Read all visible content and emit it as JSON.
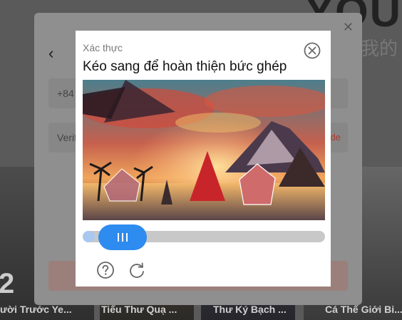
{
  "background": {
    "logo_text": "YOU",
    "side_text": "我的",
    "number_text": "2",
    "posters": [
      {
        "title": "ười Trước Ye..."
      },
      {
        "title": "Tiểu Thư Quạ ..."
      },
      {
        "title": "Thư Ký Bạch ..."
      },
      {
        "title": "Cá Thể Giới Bi..."
      }
    ]
  },
  "login": {
    "phone_prefix": "+84",
    "verify_placeholder": "Verif",
    "send_code_text": "de"
  },
  "captcha": {
    "label": "Xác thực",
    "title": "Kéo sang để hoàn thiện bức ghép",
    "slider_progress": 0.05,
    "icons": {
      "close": "close-circle-icon",
      "help": "question-icon",
      "refresh": "refresh-icon"
    },
    "colors": {
      "slider": "#2e8bf0",
      "track": "#c8c8c8"
    }
  }
}
